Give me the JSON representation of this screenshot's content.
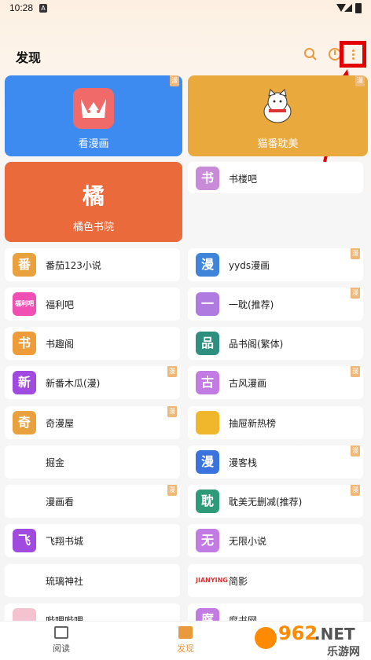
{
  "status": {
    "time": "10:28"
  },
  "header": {
    "title": "发现"
  },
  "big_cards": [
    {
      "label": "看漫画",
      "badge": "漫",
      "color": "#3d8bf0",
      "icon_text": ""
    },
    {
      "label": "猫番耽美",
      "badge": "漫",
      "color": "#e9a93c",
      "icon_text": ""
    },
    {
      "label": "橘色书院",
      "badge": "",
      "color": "#ea6a3b",
      "icon_text": "橘"
    }
  ],
  "list": [
    {
      "name": "书楼吧",
      "icon": "书",
      "color": "#c98bd8",
      "badge": ""
    },
    {
      "name": "番茄123小说",
      "icon": "番",
      "color": "#e9a13e",
      "badge": ""
    },
    {
      "name": "yyds漫画",
      "icon": "漫",
      "color": "#3f84d9",
      "badge": "漫"
    },
    {
      "name": "福利吧",
      "icon": "福利吧",
      "color": "#f04fb3",
      "badge": ""
    },
    {
      "name": "一耽(推荐)",
      "icon": "一",
      "color": "#b07be0",
      "badge": "漫"
    },
    {
      "name": "书趣阁",
      "icon": "书",
      "color": "#ee9c3a",
      "badge": ""
    },
    {
      "name": "品书阁(繁体)",
      "icon": "品",
      "color": "#2e8f7e",
      "badge": ""
    },
    {
      "name": "新番木瓜(漫)",
      "icon": "新",
      "color": "#a04ae0",
      "badge": "漫"
    },
    {
      "name": "古风漫画",
      "icon": "古",
      "color": "#c27be3",
      "badge": "漫"
    },
    {
      "name": "奇漫屋",
      "icon": "奇",
      "color": "#e9a13e",
      "badge": "漫"
    },
    {
      "name": "抽屉新热榜",
      "icon": "",
      "color": "#f1b72c",
      "badge": ""
    },
    {
      "name": "掘金",
      "icon": "",
      "color": "#ffffff",
      "badge": ""
    },
    {
      "name": "漫客栈",
      "icon": "漫",
      "color": "#3a73dd",
      "badge": "漫"
    },
    {
      "name": "漫画看",
      "icon": "",
      "color": "#ffffff",
      "badge": "漫"
    },
    {
      "name": "耽美无删减(推荐)",
      "icon": "耽",
      "color": "#2f9a78",
      "badge": "漫"
    },
    {
      "name": "飞翔书城",
      "icon": "飞",
      "color": "#a04ae0",
      "badge": ""
    },
    {
      "name": "无限小说",
      "icon": "无",
      "color": "#c27be3",
      "badge": ""
    },
    {
      "name": "琉璃神社",
      "icon": "",
      "color": "#ffffff",
      "badge": ""
    },
    {
      "name": "简影",
      "icon": "JIANYING",
      "color": "#ffffff",
      "badge": ""
    },
    {
      "name": "哔哩哔哩",
      "icon": "",
      "color": "#f5c2cf",
      "badge": ""
    },
    {
      "name": "腐书网",
      "icon": "腐",
      "color": "#c27be3",
      "badge": ""
    }
  ],
  "tabs": [
    {
      "label": "阅读"
    },
    {
      "label": "发现"
    }
  ],
  "watermark": {
    "text1": "962",
    "text2": ".NET",
    "text3": "乐游网"
  }
}
